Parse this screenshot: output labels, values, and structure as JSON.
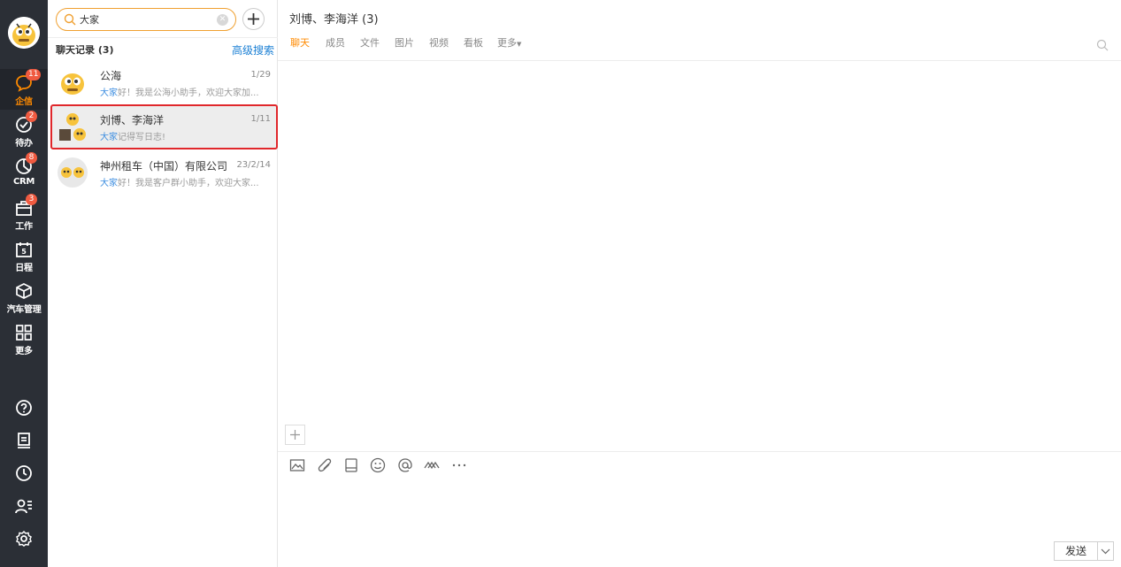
{
  "nav": {
    "items": [
      {
        "label": "企信",
        "badge": "11",
        "icon": "chat-icon"
      },
      {
        "label": "待办",
        "badge": "2",
        "icon": "check-circle-icon"
      },
      {
        "label": "CRM",
        "badge": "8",
        "icon": "pie-chart-icon"
      },
      {
        "label": "工作",
        "badge": "3",
        "icon": "briefcase-icon"
      },
      {
        "label": "日程",
        "badge": "",
        "icon": "calendar-icon"
      },
      {
        "label": "汽车管理",
        "badge": "",
        "icon": "cube-icon"
      },
      {
        "label": "更多",
        "badge": "",
        "icon": "grid-icon"
      }
    ],
    "bottom_icons": [
      "help-icon",
      "notebook-icon",
      "clock-icon",
      "contacts-icon",
      "settings-icon"
    ]
  },
  "search": {
    "value": "大家",
    "placeholder": ""
  },
  "list": {
    "header": "聊天记录 (3)",
    "advanced_search": "高级搜索",
    "chats": [
      {
        "name": "公海",
        "date": "1/29",
        "snippet_pre": "",
        "snippet_hl": "大家",
        "snippet_post": "好！我是公海小助手，欢迎大家加..."
      },
      {
        "name": "刘博、李海洋",
        "date": "1/11",
        "snippet_pre": "",
        "snippet_hl": "大家",
        "snippet_post": "记得写日志!"
      },
      {
        "name": "神州租车（中国）有限公司",
        "date": "23/2/14",
        "snippet_pre": "",
        "snippet_hl": "大家",
        "snippet_post": "好！我是客户群小助手，欢迎大家..."
      }
    ]
  },
  "main": {
    "title": "刘博、李海洋  (3)",
    "tabs": [
      "聊天",
      "成员",
      "文件",
      "图片",
      "视频",
      "看板",
      "更多"
    ],
    "send_label": "发送",
    "toolbar_icons": [
      "image-icon",
      "attachment-icon",
      "notebook-icon",
      "emoji-icon",
      "at-icon",
      "scissors-icon",
      "more-icon"
    ]
  },
  "colors": {
    "accent": "#ff8a00",
    "nav_bg": "#2b2f36",
    "badge": "#f05a40",
    "link": "#1a7fd4",
    "selection_border": "#e0272b"
  }
}
